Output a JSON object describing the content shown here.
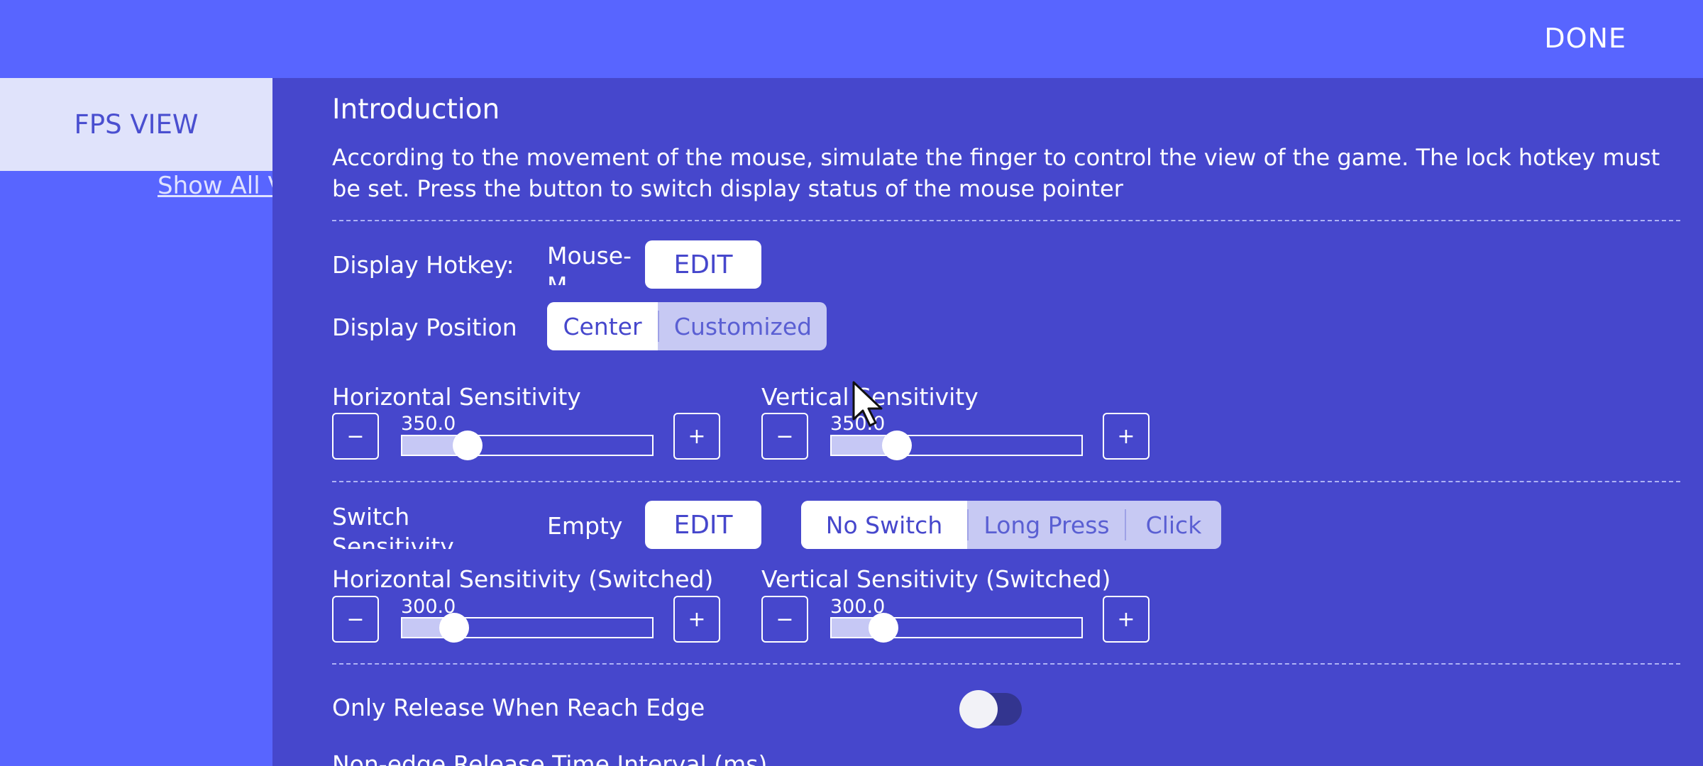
{
  "header": {
    "done_label": "DONE"
  },
  "sidebar": {
    "active_tab": "FPS VIEW",
    "show_all_link": "Show All V"
  },
  "intro": {
    "title": "Introduction",
    "text": "According to the movement of the mouse, simulate the finger to control the view of the game. The lock hotkey must be set. Press the button to switch display status of the mouse pointer"
  },
  "display_hotkey": {
    "label": "Display Hotkey:",
    "value": "Mouse-M",
    "edit_label": "EDIT"
  },
  "display_position": {
    "label": "Display Position",
    "options": [
      "Center",
      "Customized"
    ],
    "selected": "Center"
  },
  "horizontal": {
    "label": "Horizontal Sensitivity",
    "value": "350.0",
    "fraction": 0.27,
    "minus": "−",
    "plus": "+"
  },
  "vertical": {
    "label": "Vertical Sensitivity",
    "value": "350.0",
    "fraction": 0.27,
    "minus": "−",
    "plus": "+"
  },
  "switch_hotkey": {
    "label": "Switch Sensitivity Hotkey",
    "value": "Empty",
    "edit_label": "EDIT",
    "modes": [
      "No Switch",
      "Long Press",
      "Click"
    ],
    "selected_mode": "No Switch"
  },
  "horizontal_switched": {
    "label": "Horizontal Sensitivity (Switched)",
    "value": "300.0",
    "fraction": 0.21,
    "minus": "−",
    "plus": "+"
  },
  "vertical_switched": {
    "label": "Vertical Sensitivity (Switched)",
    "value": "300.0",
    "fraction": 0.21,
    "minus": "−",
    "plus": "+"
  },
  "edge_release": {
    "label": "Only Release When Reach Edge",
    "enabled": false
  },
  "non_edge": {
    "label": "Non-edge Release Time Interval (ms)"
  },
  "colors": {
    "accent": "#5865ff",
    "panel": "#4647cc",
    "tab_bg": "#e0e3fb"
  }
}
